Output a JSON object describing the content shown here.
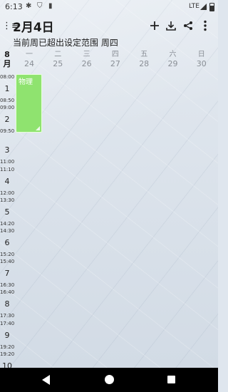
{
  "status_bar": {
    "time": "6:13",
    "network": "LTE"
  },
  "header": {
    "date_title": "2月4日",
    "subtitle": "当前周已超出设定范围  周四"
  },
  "toolbar_icons": [
    "add-icon",
    "download-icon",
    "share-icon",
    "more-vert-icon"
  ],
  "week_header": {
    "month_label": "8\n月",
    "days": [
      {
        "name": "一",
        "date": "24"
      },
      {
        "name": "二",
        "date": "25"
      },
      {
        "name": "三",
        "date": "26"
      },
      {
        "name": "四",
        "date": "27"
      },
      {
        "name": "五",
        "date": "28"
      },
      {
        "name": "六",
        "date": "29"
      },
      {
        "name": "日",
        "date": "30"
      }
    ]
  },
  "time_slots": [
    {
      "start": "08:00",
      "num": "1",
      "end": "08:50"
    },
    {
      "start": "09:00",
      "num": "2",
      "end": "09:50"
    },
    {
      "start": "",
      "num": "3",
      "end": "11:00"
    },
    {
      "start": "11:10",
      "num": "4",
      "end": "12:00"
    },
    {
      "start": "13:30",
      "num": "5",
      "end": "14:20"
    },
    {
      "start": "14:30",
      "num": "6",
      "end": "15:20"
    },
    {
      "start": "15:40",
      "num": "7",
      "end": "16:30"
    },
    {
      "start": "16:40",
      "num": "8",
      "end": "17:30"
    },
    {
      "start": "17:40",
      "num": "9",
      "end": "19:20"
    },
    {
      "start": "19:20",
      "num": "10",
      "end": ""
    }
  ],
  "event": {
    "title": "物理"
  }
}
